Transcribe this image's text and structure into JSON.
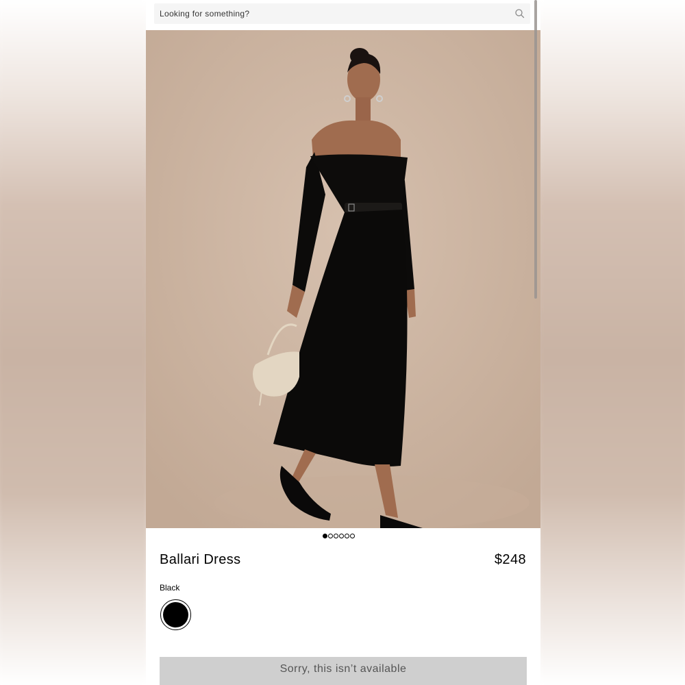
{
  "search": {
    "placeholder": "Looking for something?",
    "icon": "search-icon"
  },
  "gallery": {
    "image_alt": "Model wearing black off-the-shoulder midi dress with belt, holding a cream handbag",
    "total_images": 6,
    "current_index": 1
  },
  "product": {
    "name": "Ballari Dress",
    "price": "$248"
  },
  "color": {
    "selected_label": "Black",
    "swatches": [
      {
        "name": "Black",
        "hex": "#000000",
        "selected": true
      }
    ]
  },
  "actions": {
    "unavailable_label": "Sorry, this isn’t available"
  },
  "colors": {
    "background": "#ffffff",
    "text": "#000000",
    "button_disabled": "#cfcfcf",
    "button_disabled_text": "#555555",
    "photo_backdrop": "#cdb5a3"
  }
}
